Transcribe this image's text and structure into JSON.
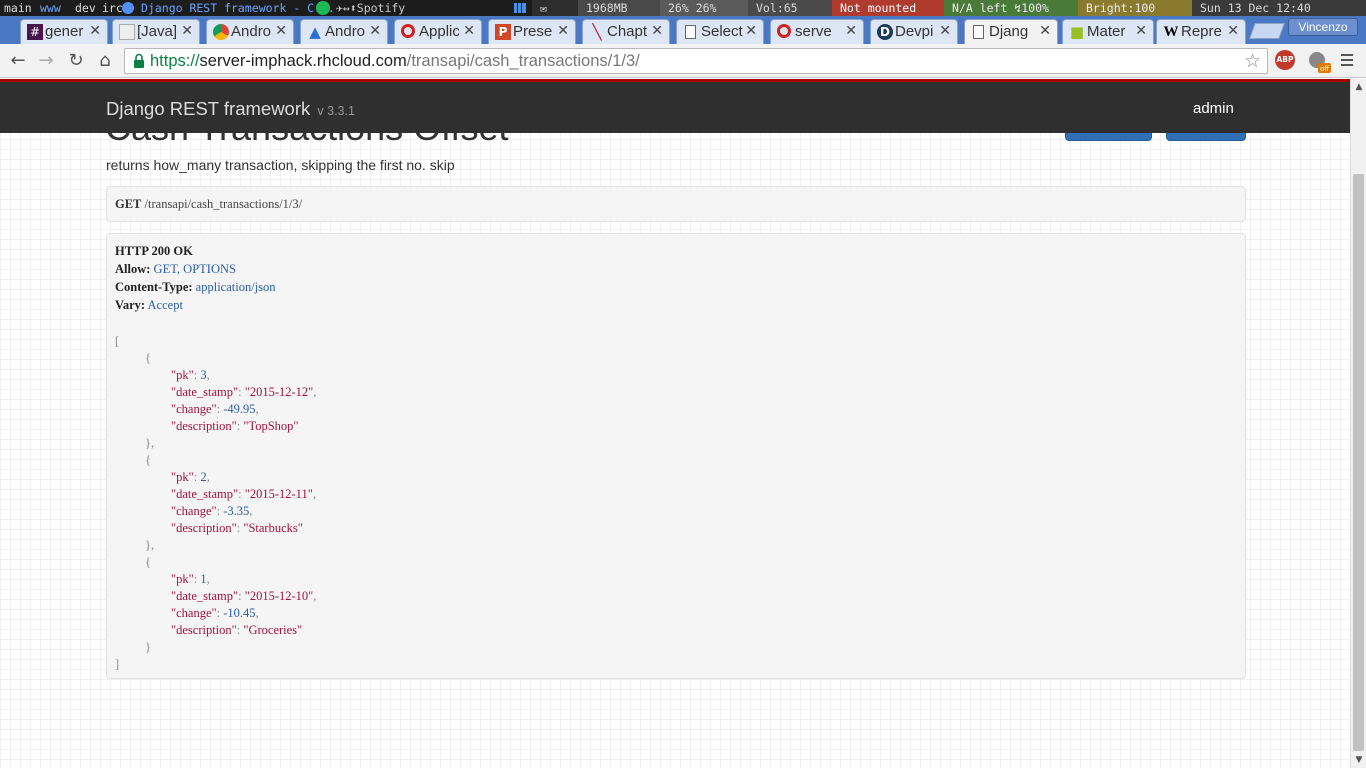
{
  "system_bar": {
    "workspaces": [
      "main",
      "www",
      "dev",
      "irc"
    ],
    "active_workspace": "www",
    "window_title": "Django REST framework - C...",
    "music": "✈↔⬍Spotify",
    "memory": "1968MB",
    "cpu": "26% 26%",
    "volume": "Vol:65",
    "mount": "Not mounted",
    "battery": "N/A left ↯100%",
    "brightness": "Bright:100",
    "clock": "Sun 13 Dec 12:40"
  },
  "tabs": [
    {
      "label": "gener",
      "icon": "hash-icon"
    },
    {
      "label": "[Java]",
      "icon": "grid-icon"
    },
    {
      "label": "Andro",
      "icon": "chrome-icon"
    },
    {
      "label": "Andro",
      "icon": "triangle-icon"
    },
    {
      "label": "Applic",
      "icon": "openshift-icon"
    },
    {
      "label": "Prese",
      "icon": "powerpoint-icon"
    },
    {
      "label": "Chapt",
      "icon": "slash-icon"
    },
    {
      "label": "Select",
      "icon": "page-icon"
    },
    {
      "label": "serve",
      "icon": "openshift-icon"
    },
    {
      "label": "Devpi",
      "icon": "devpi-icon"
    },
    {
      "label": "Djang",
      "icon": "page-icon",
      "active": true
    },
    {
      "label": "Mater",
      "icon": "android-icon"
    },
    {
      "label": "Repre",
      "icon": "wikipedia-icon"
    }
  ],
  "profile_name": "Vincenzo",
  "address_bar": {
    "scheme": "https://",
    "host": "server-imphack.rhcloud.com",
    "path": "/transapi/cash_transactions/1/3/"
  },
  "abp_label": "ABP",
  "ext_badge": "off",
  "navbar": {
    "brand": "Django REST framework",
    "version": "v 3.3.1",
    "user": "admin"
  },
  "page": {
    "title": "Cash Transactions Offset",
    "description": "returns how_many transaction, skipping the first no. skip",
    "request": {
      "method": "GET",
      "path": "/transapi/cash_transactions/1/3/"
    },
    "response": {
      "status": "HTTP 200 OK",
      "headers": [
        {
          "name": "Allow:",
          "value": "GET, OPTIONS"
        },
        {
          "name": "Content-Type:",
          "value": "application/json"
        },
        {
          "name": "Vary:",
          "value": "Accept"
        }
      ],
      "body": [
        {
          "pk": "3",
          "date_stamp": "\"2015-12-12\"",
          "change": "-49.95",
          "description": "\"TopShop\""
        },
        {
          "pk": "2",
          "date_stamp": "\"2015-12-11\"",
          "change": "-3.35",
          "description": "\"Starbucks\""
        },
        {
          "pk": "1",
          "date_stamp": "\"2015-12-10\"",
          "change": "-10.45",
          "description": "\"Groceries\""
        }
      ],
      "keys": {
        "pk": "\"pk\"",
        "date_stamp": "\"date_stamp\"",
        "change": "\"change\"",
        "description": "\"description\""
      }
    }
  },
  "colors": {
    "tab_strip": "#4a78c2",
    "navbar": "#2f2f2f",
    "accent_red": "#a30000",
    "button_blue": "#2f6fb5"
  }
}
